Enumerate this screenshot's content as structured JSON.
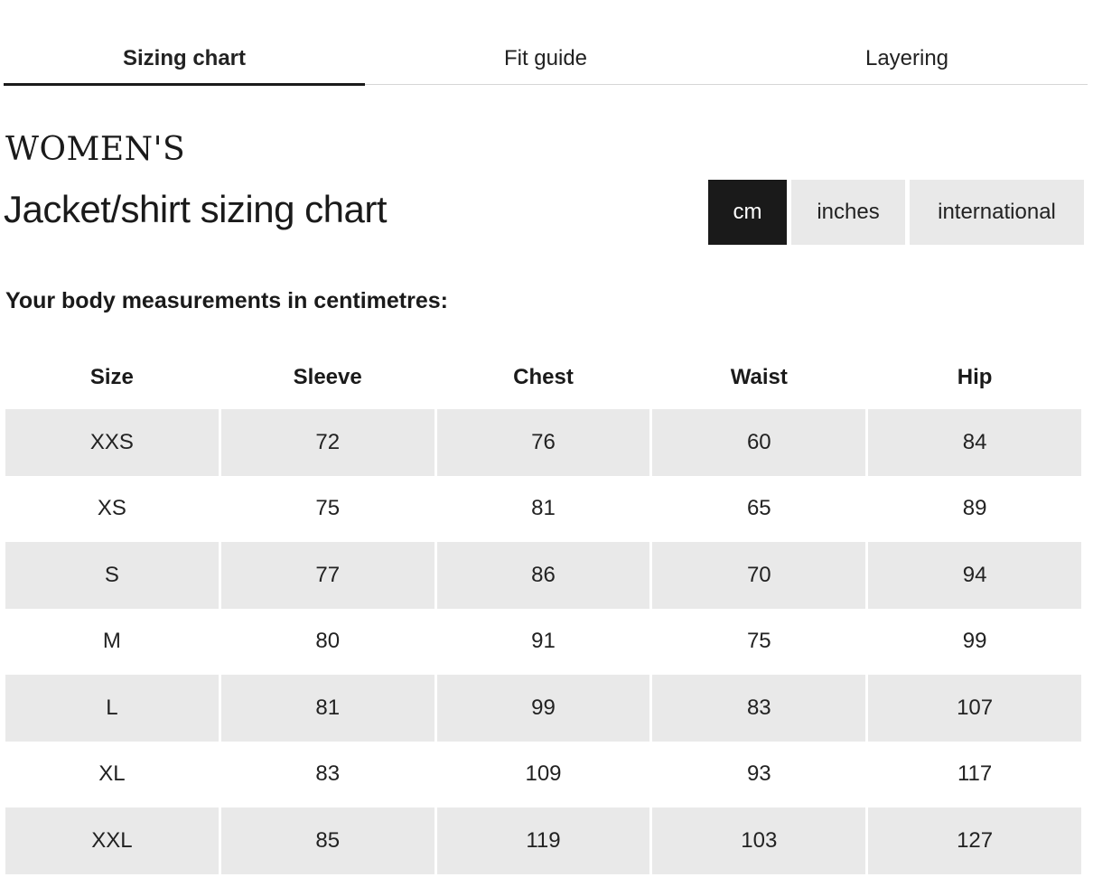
{
  "tabs": [
    {
      "label": "Sizing chart",
      "active": true
    },
    {
      "label": "Fit guide",
      "active": false
    },
    {
      "label": "Layering",
      "active": false
    }
  ],
  "heading": {
    "category": "WOMEN'S",
    "title": "Jacket/shirt sizing chart"
  },
  "units": {
    "cm": "cm",
    "inches": "inches",
    "international": "international",
    "selected": "cm"
  },
  "subtitle": "Your body measurements in centimetres:",
  "table": {
    "headers": [
      "Size",
      "Sleeve",
      "Chest",
      "Waist",
      "Hip"
    ],
    "rows": [
      [
        "XXS",
        "72",
        "76",
        "60",
        "84"
      ],
      [
        "XS",
        "75",
        "81",
        "65",
        "89"
      ],
      [
        "S",
        "77",
        "86",
        "70",
        "94"
      ],
      [
        "M",
        "80",
        "91",
        "75",
        "99"
      ],
      [
        "L",
        "81",
        "99",
        "83",
        "107"
      ],
      [
        "XL",
        "83",
        "109",
        "93",
        "117"
      ],
      [
        "XXL",
        "85",
        "119",
        "103",
        "127"
      ]
    ]
  },
  "colors": {
    "active_tab_underline": "#1a1a1a",
    "selected_unit_bg": "#1a1a1a",
    "unselected_unit_bg": "#e9e9e9",
    "shaded_row_bg": "#e9e9e9"
  }
}
